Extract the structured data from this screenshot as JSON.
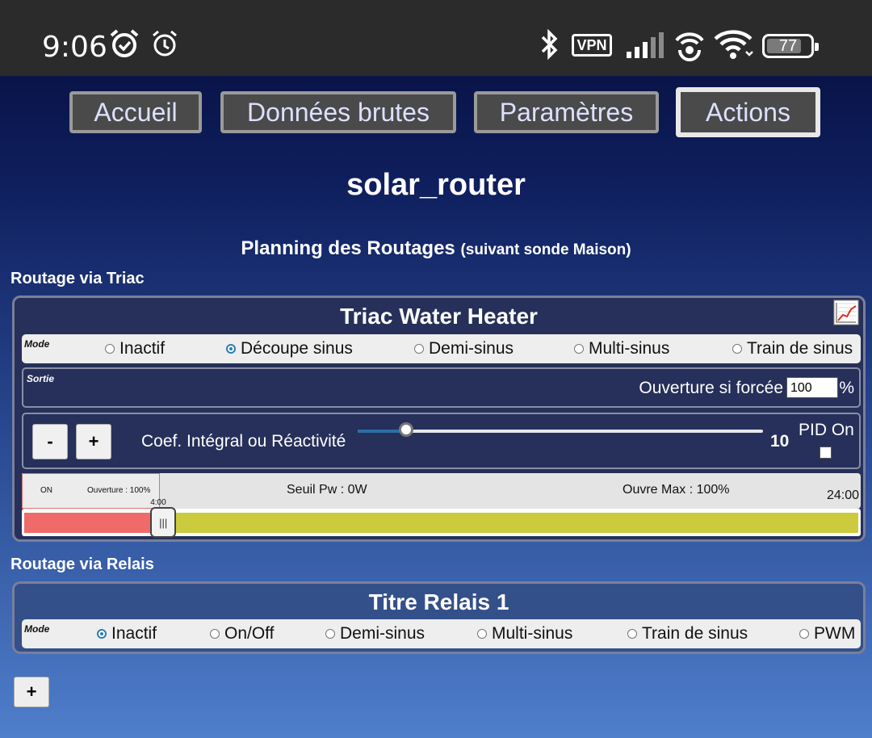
{
  "status_bar": {
    "time": "9:06",
    "vpn": "VPN",
    "battery": "77",
    "icons": [
      "alarm-icon",
      "alarm-outline-icon",
      "bluetooth-icon",
      "signal-icon",
      "hotspot-icon",
      "wifi-icon"
    ]
  },
  "nav": {
    "tabs": [
      {
        "label": "Accueil",
        "active": false
      },
      {
        "label": "Données brutes",
        "active": false
      },
      {
        "label": "Paramètres",
        "active": false
      },
      {
        "label": "Actions",
        "active": true
      }
    ]
  },
  "page": {
    "title": "solar_router",
    "planning_title": "Planning des Routages",
    "planning_subtitle": "(suivant sonde Maison)"
  },
  "triac_section": {
    "heading": "Routage via Triac",
    "title": "Triac Water Heater",
    "mode_label": "Mode",
    "modes": [
      "Inactif",
      "Découpe sinus",
      "Demi-sinus",
      "Multi-sinus",
      "Train de sinus"
    ],
    "selected_mode": "Découpe sinus",
    "sortie_label": "Sortie",
    "ouverture_label": "Ouverture si forcée",
    "ouverture_value": "100",
    "ouverture_unit": "%",
    "minus_label": "-",
    "plus_label": "+",
    "coef_label": "Coef. Intégral ou Réactivité",
    "coef_value": "10",
    "coef_slider_fraction": 0.12,
    "pid_label": "PID On",
    "pid_checked": false,
    "schedule": {
      "seg_on": "ON",
      "seg_ouverture": "Ouverture : 100%",
      "seuil": "Seuil Pw : 0W",
      "ouvre_max": "Ouvre Max : 100%",
      "end_time": "24:00",
      "handle_time": "4:00",
      "handle_fraction": 0.1667,
      "colors": {
        "on_segment": "#f06a6a",
        "rest_segment": "#cccb3e"
      }
    }
  },
  "relais_section": {
    "heading": "Routage via Relais",
    "title": "Titre Relais 1",
    "mode_label": "Mode",
    "modes": [
      "Inactif",
      "On/Off",
      "Demi-sinus",
      "Multi-sinus",
      "Train de sinus",
      "PWM"
    ],
    "selected_mode": "Inactif"
  },
  "add_button_label": "+"
}
